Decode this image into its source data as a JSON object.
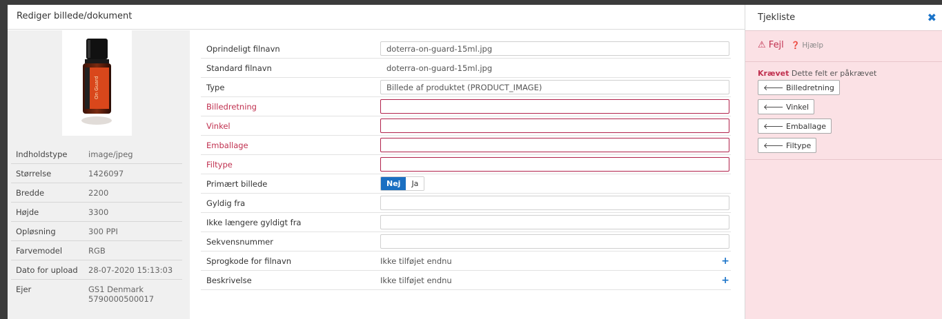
{
  "modal": {
    "title": "Rediger billede/dokument"
  },
  "metadata": [
    {
      "key": "Indholdstype",
      "value": "image/jpeg"
    },
    {
      "key": "Størrelse",
      "value": "1426097"
    },
    {
      "key": "Bredde",
      "value": "2200"
    },
    {
      "key": "Højde",
      "value": "3300"
    },
    {
      "key": "Opløsning",
      "value": "300 PPI"
    },
    {
      "key": "Farvemodel",
      "value": "RGB"
    },
    {
      "key": "Dato for upload",
      "value": "28-07-2020 15:13:03"
    },
    {
      "key": "Ejer",
      "value": "GS1 Denmark\n5790000500017"
    }
  ],
  "thumbnail": {
    "label": "On Guard",
    "brand": "dōTERRA"
  },
  "form": {
    "original_filename_label": "Oprindeligt filnavn",
    "original_filename_value": "doterra-on-guard-15ml.jpg",
    "standard_filename_label": "Standard filnavn",
    "standard_filename_value": "doterra-on-guard-15ml.jpg",
    "type_label": "Type",
    "type_value": "Billede af produktet (PRODUCT_IMAGE)",
    "direction_label": "Billedretning",
    "angle_label": "Vinkel",
    "packaging_label": "Emballage",
    "filetype_label": "Filtype",
    "primary_label": "Primært billede",
    "primary_no": "Nej",
    "primary_yes": "Ja",
    "valid_from_label": "Gyldig fra",
    "valid_to_label": "Ikke længere gyldigt fra",
    "sequence_label": "Sekvensnummer",
    "language_label": "Sprogkode for filnavn",
    "language_value": "Ikke tilføjet endnu",
    "description_label": "Beskrivelse",
    "description_value": "Ikke tilføjet endnu"
  },
  "checklist": {
    "title": "Tjekliste",
    "error_title": "Fejl",
    "help": "Hjælp",
    "required_tag": "Krævet",
    "required_text": "Dette felt er påkrævet",
    "buttons": [
      "Billedretning",
      "Vinkel",
      "Emballage",
      "Filtype"
    ]
  },
  "colors": {
    "accent": "#1a6fc2",
    "error": "#c0304f",
    "side_bg": "#fbe1e5"
  }
}
